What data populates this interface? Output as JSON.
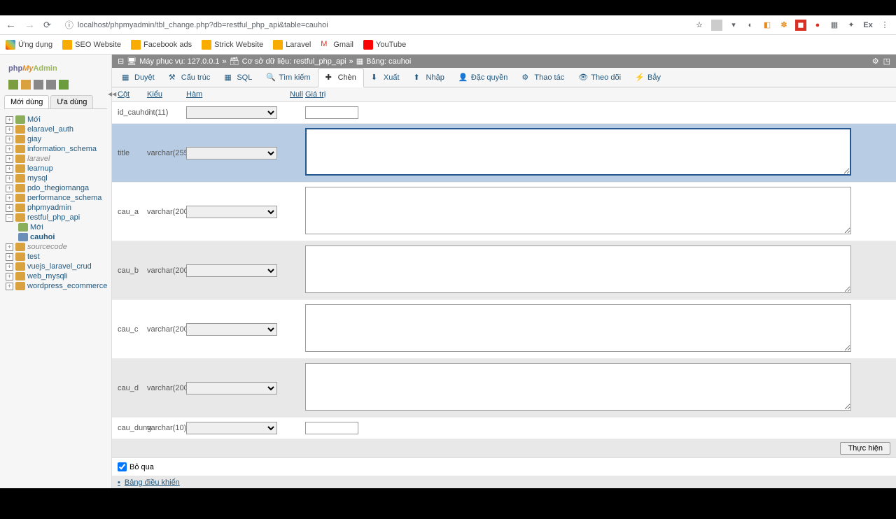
{
  "browser": {
    "url": "localhost/phpmyadmin/tbl_change.php?db=restful_php_api&table=cauhoi",
    "star": "☆",
    "ext_labels": {
      "ex": "Ex"
    }
  },
  "bookmarks": [
    {
      "label": "Ứng dụng",
      "color": "#d93025"
    },
    {
      "label": "SEO Website",
      "color": "#f9ab00"
    },
    {
      "label": "Facebook ads",
      "color": "#f9ab00"
    },
    {
      "label": "Strick Website",
      "color": "#f9ab00"
    },
    {
      "label": "Laravel",
      "color": "#f9ab00"
    },
    {
      "label": "Gmail",
      "color": "#d93025"
    },
    {
      "label": "YouTube",
      "color": "#ff0000"
    }
  ],
  "logo": {
    "php": "php",
    "my": "My",
    "admin": "Admin"
  },
  "side_tabs": {
    "recent": "Mới dùng",
    "fav": "Ưa dùng"
  },
  "tree": [
    {
      "label": "Mới",
      "type": "new"
    },
    {
      "label": "elaravel_auth",
      "type": "db"
    },
    {
      "label": "giay",
      "type": "db"
    },
    {
      "label": "information_schema",
      "type": "db"
    },
    {
      "label": "laravel",
      "type": "db",
      "italic": true
    },
    {
      "label": "learnup",
      "type": "db"
    },
    {
      "label": "mysql",
      "type": "db"
    },
    {
      "label": "pdo_thegiomanga",
      "type": "db"
    },
    {
      "label": "performance_schema",
      "type": "db"
    },
    {
      "label": "phpmyadmin",
      "type": "db"
    },
    {
      "label": "restful_php_api",
      "type": "db",
      "expanded": true,
      "children": [
        {
          "label": "Mới",
          "type": "new"
        },
        {
          "label": "cauhoi",
          "type": "table",
          "bold": true
        }
      ]
    },
    {
      "label": "sourcecode",
      "type": "db",
      "italic": true
    },
    {
      "label": "test",
      "type": "db"
    },
    {
      "label": "vuejs_laravel_crud",
      "type": "db"
    },
    {
      "label": "web_mysqli",
      "type": "db"
    },
    {
      "label": "wordpress_ecommerce",
      "type": "db"
    }
  ],
  "breadcrumb": {
    "server": "Máy phục vụ: 127.0.0.1",
    "db": "Cơ sở dữ liệu: restful_php_api",
    "table": "Bảng: cauhoi"
  },
  "tabs": [
    {
      "label": "Duyệt"
    },
    {
      "label": "Cấu trúc"
    },
    {
      "label": "SQL"
    },
    {
      "label": "Tìm kiếm"
    },
    {
      "label": "Chèn",
      "active": true
    },
    {
      "label": "Xuất"
    },
    {
      "label": "Nhập"
    },
    {
      "label": "Đặc quyền"
    },
    {
      "label": "Thao tác"
    },
    {
      "label": "Theo dõi"
    },
    {
      "label": "Bẫy"
    }
  ],
  "headers": {
    "cot": "Cột",
    "kieu": "Kiểu",
    "ham": "Hàm",
    "null": "Null",
    "giatri": "Giá trị"
  },
  "rows": [
    {
      "name": "id_cauhoi",
      "type": "int(11)",
      "input": "text"
    },
    {
      "name": "title",
      "type": "varchar(255)",
      "input": "textarea",
      "focused": true
    },
    {
      "name": "cau_a",
      "type": "varchar(200)",
      "input": "textarea"
    },
    {
      "name": "cau_b",
      "type": "varchar(200)",
      "input": "textarea",
      "alt": true
    },
    {
      "name": "cau_c",
      "type": "varchar(200)",
      "input": "textarea"
    },
    {
      "name": "cau_d",
      "type": "varchar(200)",
      "input": "textarea",
      "alt": true
    },
    {
      "name": "cau_dung",
      "type": "varchar(10)",
      "input": "text"
    }
  ],
  "submit": "Thực hiện",
  "skip": "Bỏ qua",
  "panel": "Bảng điều khiển"
}
